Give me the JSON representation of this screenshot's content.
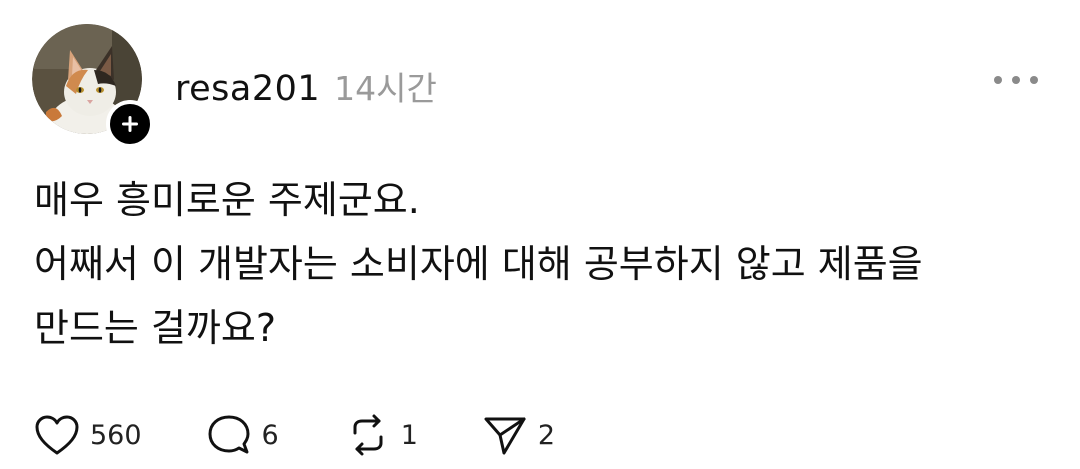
{
  "post": {
    "username": "resa201",
    "time": "14시간",
    "body_lines": [
      "매우 흥미로운 주제군요.",
      "어째서 이 개발자는 소비자에 대해 공부하지 않고 제품을",
      "만드는 걸까요?"
    ]
  },
  "actions": {
    "likes": "560",
    "replies": "6",
    "reposts": "1",
    "shares": "2"
  },
  "icons": {
    "avatar": "cat-avatar",
    "follow": "plus-icon",
    "more": "more-horizontal-icon",
    "like": "heart-icon",
    "reply": "comment-icon",
    "repost": "repost-icon",
    "share": "send-icon"
  }
}
